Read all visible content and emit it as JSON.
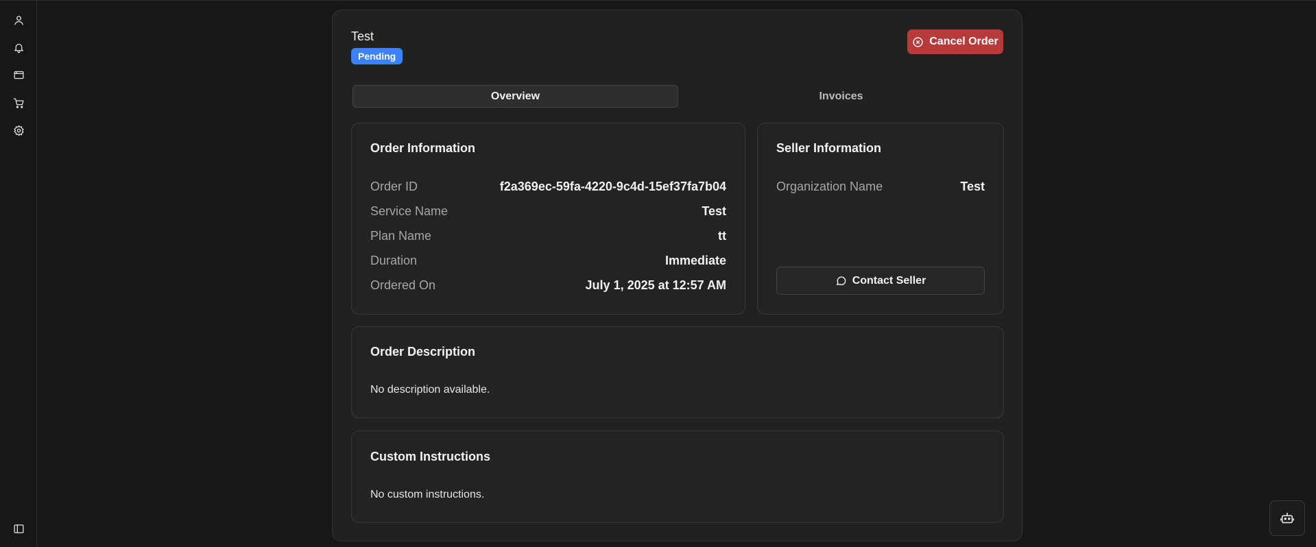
{
  "sidebar": {
    "items": [
      {
        "name": "user-icon"
      },
      {
        "name": "bell-icon"
      },
      {
        "name": "browser-window-icon"
      },
      {
        "name": "cart-icon"
      },
      {
        "name": "gear-icon"
      }
    ],
    "toggle_icon": "sidebar-toggle-icon"
  },
  "header": {
    "title": "Test",
    "status": "Pending",
    "cancel_label": "Cancel Order"
  },
  "tabs": [
    {
      "label": "Overview",
      "active": true
    },
    {
      "label": "Invoices",
      "active": false
    }
  ],
  "order_info": {
    "title": "Order Information",
    "rows": [
      {
        "label": "Order ID",
        "value": "f2a369ec-59fa-4220-9c4d-15ef37fa7b04"
      },
      {
        "label": "Service Name",
        "value": "Test"
      },
      {
        "label": "Plan Name",
        "value": "tt"
      },
      {
        "label": "Duration",
        "value": "Immediate"
      },
      {
        "label": "Ordered On",
        "value": "July 1, 2025 at 12:57 AM"
      }
    ]
  },
  "seller_info": {
    "title": "Seller Information",
    "rows": [
      {
        "label": "Organization Name",
        "value": "Test"
      }
    ],
    "contact_label": "Contact Seller"
  },
  "description": {
    "title": "Order Description",
    "text": "No description available."
  },
  "instructions": {
    "title": "Custom Instructions",
    "text": "No custom instructions."
  },
  "colors": {
    "background": "#171717",
    "panel": "#212121",
    "status_badge": "#3b82f6",
    "cancel_button": "#b83a3a"
  }
}
